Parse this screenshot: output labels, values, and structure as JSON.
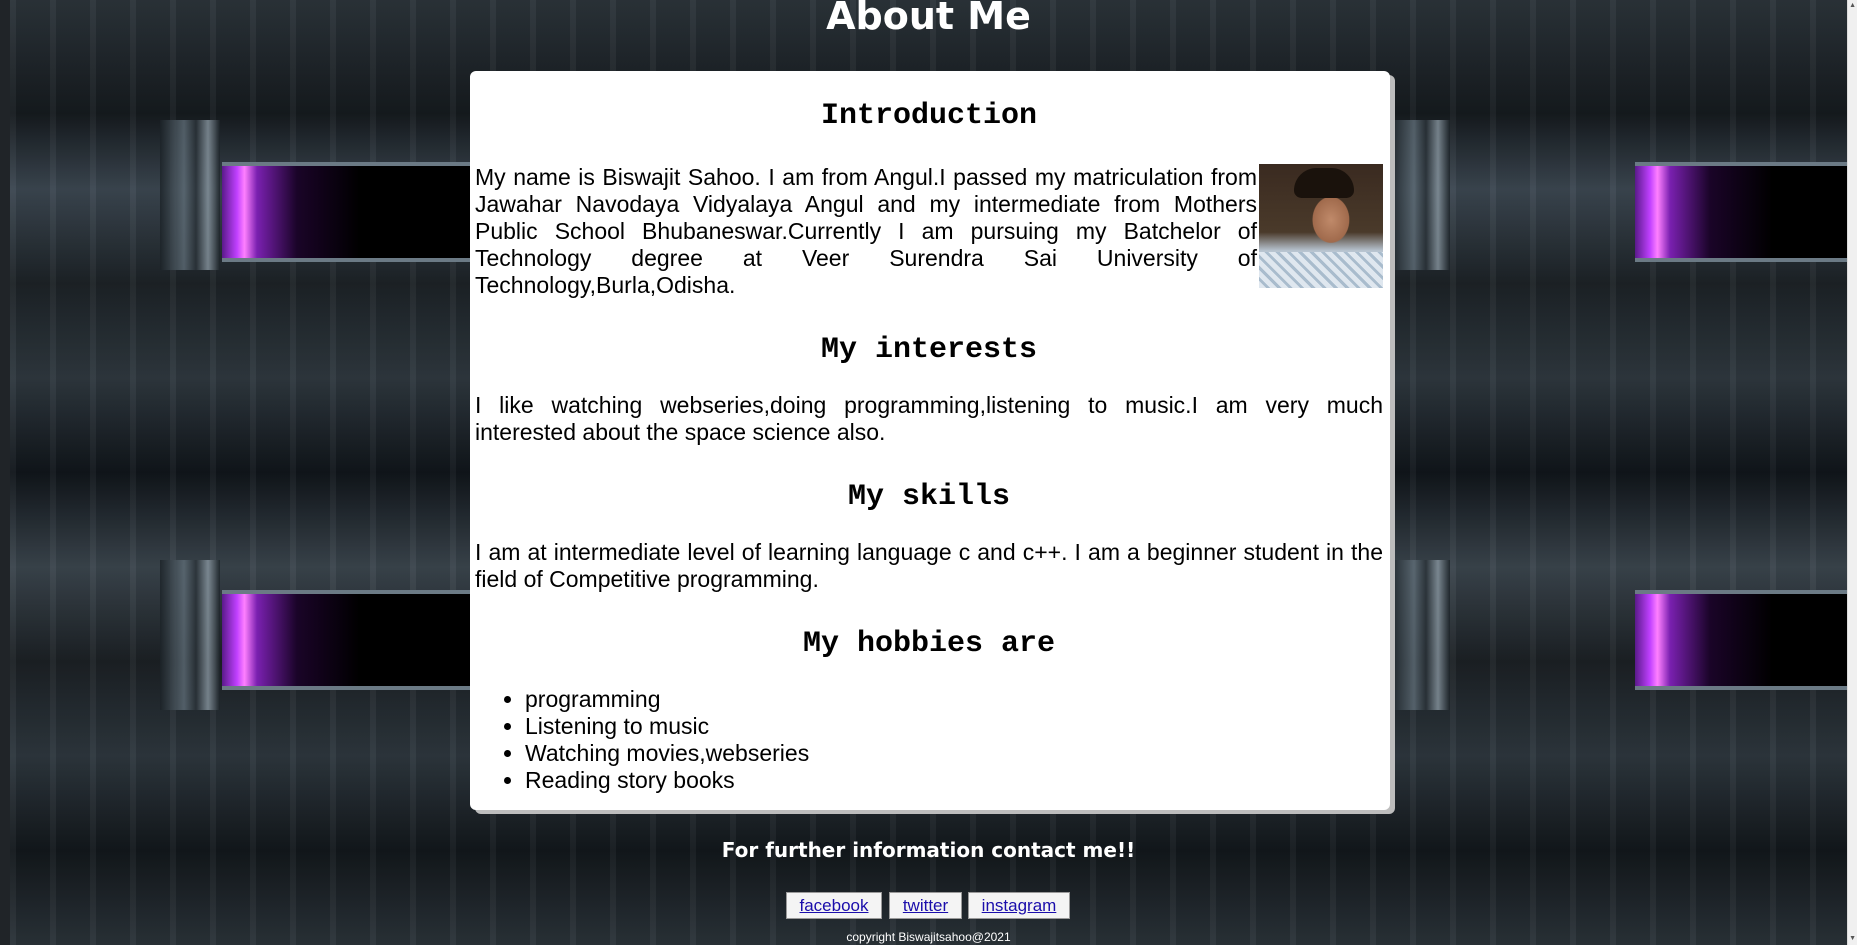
{
  "page": {
    "title": "About Me"
  },
  "sections": {
    "introduction": {
      "heading": "Introduction",
      "text": "My name is Biswajit Sahoo. I am from Angul.I passed my matriculation from Jawahar Navodaya Vidyalaya Angul and my intermediate from Mothers Public School Bhubaneswar.Currently I am pursuing my Batchelor of Technology degree at Veer Surendra Sai University of Technology,Burla,Odisha."
    },
    "interests": {
      "heading": "My interests",
      "text": "I like watching webseries,doing programming,listening to music.I am very much interested about the space science also."
    },
    "skills": {
      "heading": "My skills",
      "text": "I am at intermediate level of learning language c and c++. I am a beginner student in the field of Competitive programming."
    },
    "hobbies": {
      "heading": "My hobbies are",
      "items": [
        "programming",
        "Listening to music",
        "Watching movies,webseries",
        "Reading story books"
      ]
    }
  },
  "footer": {
    "contact_text": "For further information contact me!!",
    "links": {
      "facebook": "facebook",
      "twitter": "twitter",
      "instagram": "instagram"
    },
    "copyright": "copyright Biswajitsahoo@2021"
  },
  "colors": {
    "card_background": "#ffffff",
    "link": "#1a0dab",
    "heading_text": "#ffffff",
    "portal_accent": "#c040ff"
  }
}
